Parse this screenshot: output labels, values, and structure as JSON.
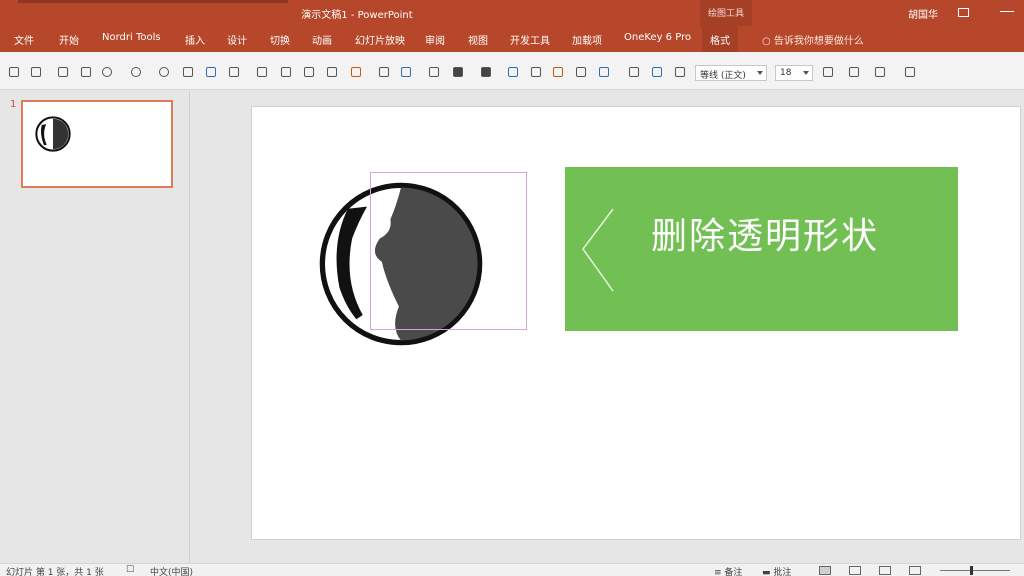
{
  "titlebar": {
    "doc_title": "演示文稿1 - PowerPoint",
    "context_group": "绘图工具",
    "user": "胡国华"
  },
  "ribbon": {
    "tabs": [
      "文件",
      "开始",
      "Nordri Tools",
      "插入",
      "设计",
      "切换",
      "动画",
      "幻灯片放映",
      "审阅",
      "视图",
      "开发工具",
      "加载项",
      "OneKey 6 Pro",
      "格式"
    ],
    "active_tab": "格式",
    "tell_me": "告诉我你想要做什么"
  },
  "toolbar": {
    "font_name": "等线 (正文)",
    "font_size": "18"
  },
  "thumbnails": {
    "slide_number": "1"
  },
  "slide": {
    "shape_text": "删除透明形状",
    "shape_color": "#72bf53"
  },
  "statusbar": {
    "slide_info": "幻灯片 第 1 张，共 1 张",
    "language": "中文(中国)",
    "notes": "备注",
    "comments": "批注"
  }
}
